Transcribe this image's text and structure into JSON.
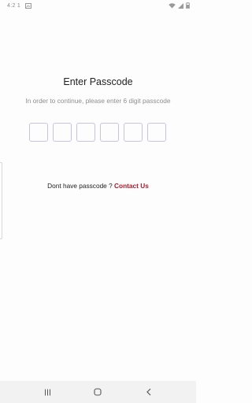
{
  "status_bar": {
    "time": "4:2 1"
  },
  "screen": {
    "title": "Enter Passcode",
    "subtitle": "In order to continue, please enter 6 digit passcode",
    "passcode_digits": [
      "",
      "",
      "",
      "",
      "",
      ""
    ],
    "contact_prompt": "Dont have passcode ? ",
    "contact_link": "Contact Us"
  },
  "colors": {
    "link": "#b0182a",
    "box_border": "#c9c3e3",
    "subtitle": "#8e8e8e"
  },
  "nav_bar": {
    "icons": [
      "recent-apps-icon",
      "home-icon",
      "back-icon"
    ]
  }
}
